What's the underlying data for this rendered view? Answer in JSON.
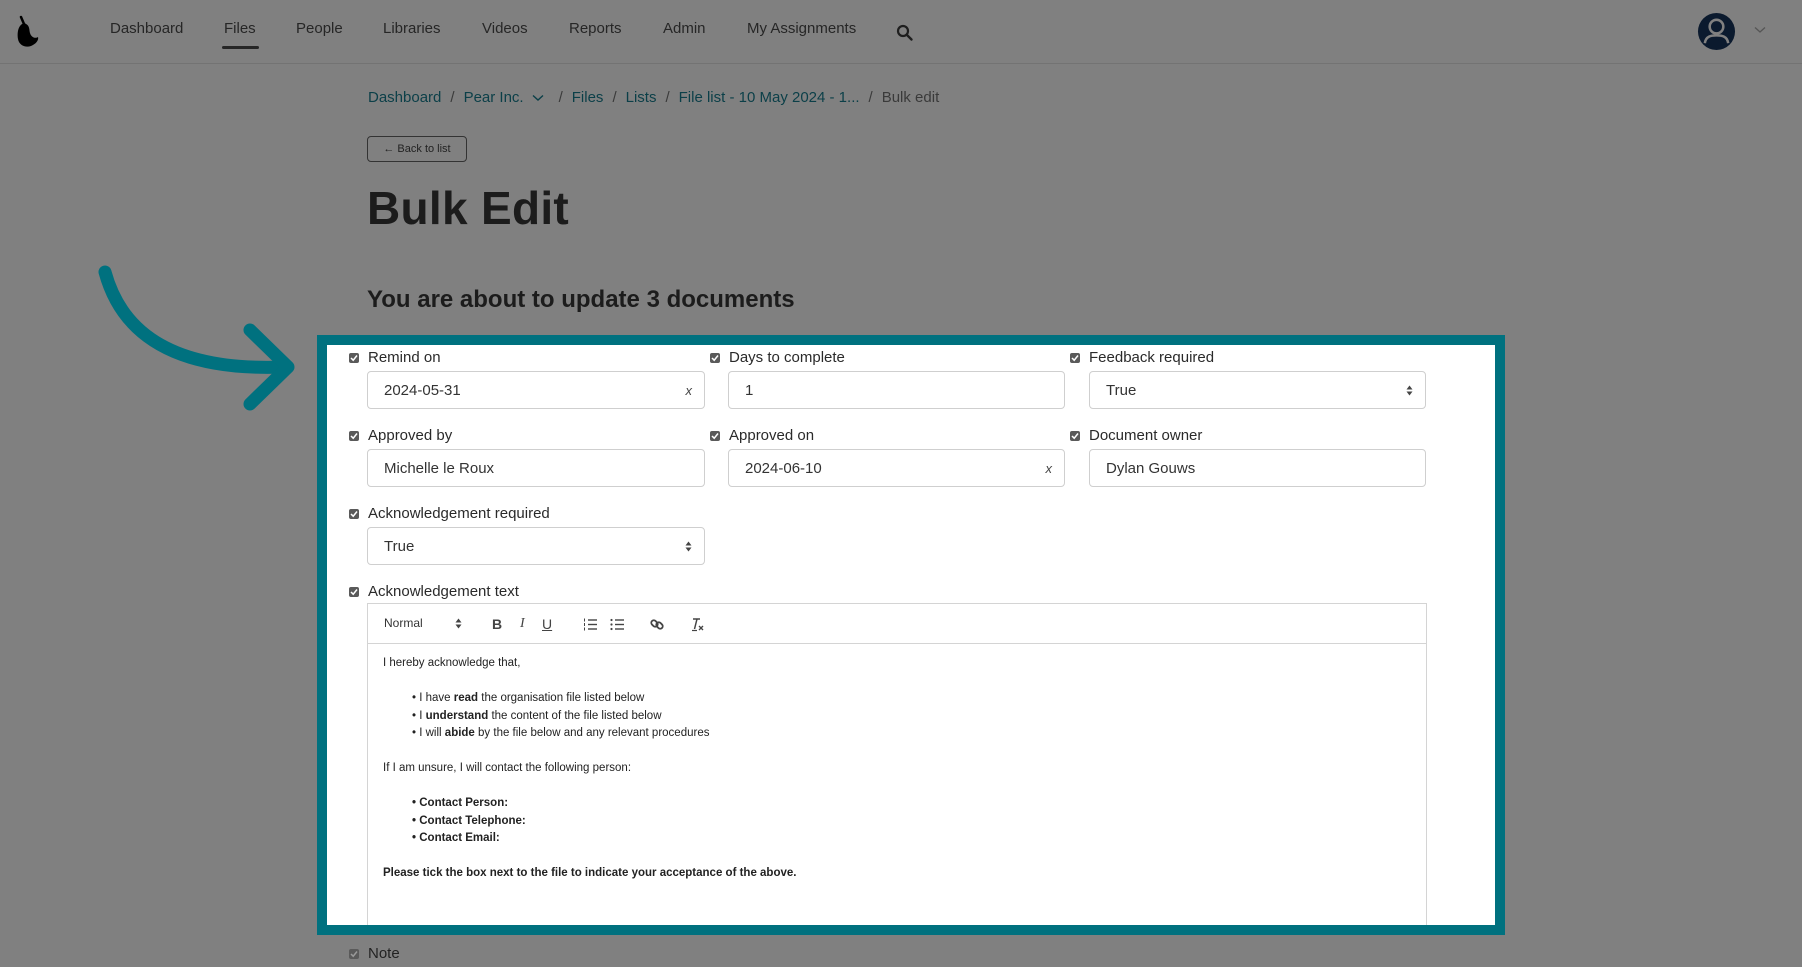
{
  "nav": {
    "items": [
      {
        "label": "Dashboard"
      },
      {
        "label": "Files",
        "active": true
      },
      {
        "label": "People"
      },
      {
        "label": "Libraries"
      },
      {
        "label": "Videos"
      },
      {
        "label": "Reports"
      },
      {
        "label": "Admin"
      },
      {
        "label": "My Assignments"
      }
    ],
    "search_icon": "search-icon",
    "avatar_icon": "user-avatar-icon",
    "logo_icon": "pear-logo-icon"
  },
  "breadcrumb": {
    "items": [
      "Dashboard",
      "Pear Inc.",
      "Files",
      "Lists",
      "File list - 10 May 2024 - 1..."
    ],
    "current": "Bulk edit",
    "separator": "/"
  },
  "back_button": "← Back to list",
  "page_title": "Bulk Edit",
  "subtitle": "You are about to update 3 documents",
  "highlight_color": "#00717f",
  "form": {
    "remind_on": {
      "label": "Remind on",
      "value": "2024-05-31",
      "checked": true,
      "clear": "x"
    },
    "days_to_complete": {
      "label": "Days to complete",
      "value": "1",
      "checked": true
    },
    "feedback_required": {
      "label": "Feedback required",
      "value": "True",
      "checked": true
    },
    "approved_by": {
      "label": "Approved by",
      "value": "Michelle le Roux",
      "checked": true
    },
    "approved_on": {
      "label": "Approved on",
      "value": "2024-06-10",
      "checked": true,
      "clear": "x"
    },
    "document_owner": {
      "label": "Document owner",
      "value": "Dylan Gouws",
      "checked": true
    },
    "acknowledgement_required": {
      "label": "Acknowledgement required",
      "value": "True",
      "checked": true
    },
    "acknowledgement_text": {
      "label": "Acknowledgement text",
      "checked": true,
      "toolbar": {
        "format": "Normal",
        "bold": "B",
        "italic": "I",
        "underline": "U"
      },
      "content": {
        "intro": "I hereby acknowledge that,",
        "bullets": [
          {
            "pre": "I have ",
            "bold": "read",
            "post": " the organisation file listed below"
          },
          {
            "pre": "I ",
            "bold": "understand",
            "post": " the content of the file listed below"
          },
          {
            "pre": "I will ",
            "bold": "abide",
            "post": " by the file below and any relevant procedures"
          }
        ],
        "contact_intro": "If I am unsure, I will contact the following person:",
        "contacts": [
          "Contact Person:",
          "Contact Telephone:",
          "Contact Email:"
        ],
        "closing": "Please tick the box next to the file to indicate your acceptance of the above."
      }
    },
    "note": {
      "label": "Note",
      "checked": true
    }
  }
}
